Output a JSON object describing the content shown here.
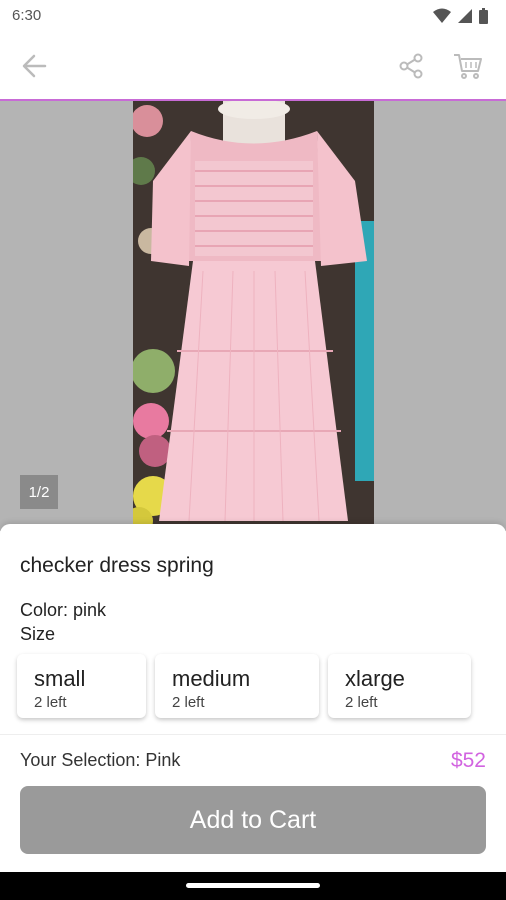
{
  "status_bar": {
    "time": "6:30"
  },
  "header": {
    "back_icon": "arrow-left-icon",
    "share_icon": "share-icon",
    "cart_icon": "cart-icon"
  },
  "gallery": {
    "page_indicator": "1/2"
  },
  "product": {
    "title": "checker dress spring",
    "color_line": "Color: pink",
    "size_label": "Size",
    "sizes": [
      {
        "name": "small",
        "stock": "2 left"
      },
      {
        "name": "medium",
        "stock": "2 left"
      },
      {
        "name": "xlarge",
        "stock": "2 left"
      }
    ]
  },
  "footer": {
    "selection": "Your Selection: Pink",
    "price": "$52",
    "add_to_cart": "Add to Cart"
  },
  "colors": {
    "accent": "#d264e0",
    "header_rule": "#c86bd6",
    "cta_disabled": "#9a9a9a"
  }
}
